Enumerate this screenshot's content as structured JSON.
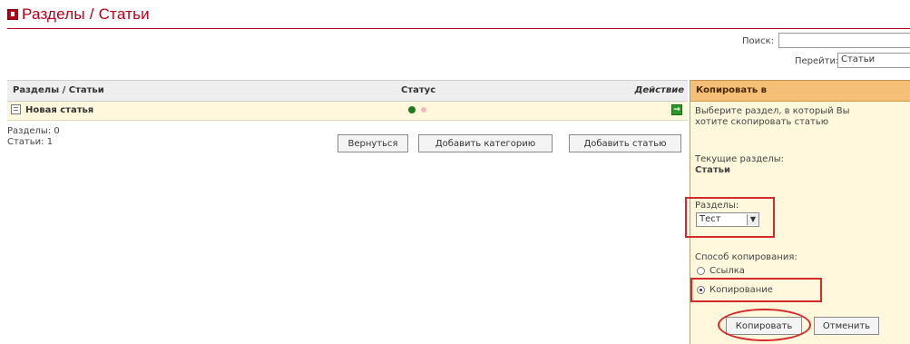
{
  "header": {
    "title": "Разделы / Статьи",
    "search_label": "Поиск:",
    "search_value": "",
    "goto_label": "Перейти:",
    "goto_selected": "Статьи"
  },
  "table": {
    "columns": [
      "Разделы / Статьи",
      "Статус",
      "Действие"
    ],
    "rows": [
      {
        "title": "Новая статья"
      }
    ]
  },
  "stats": {
    "sections": "Разделы: 0",
    "articles": "Статьи: 1"
  },
  "buttons": {
    "back": "Вернуться",
    "add_category": "Добавить категорию",
    "add_article": "Добавить статью"
  },
  "copy_panel": {
    "header": "Копировать в",
    "instructions_1": "Выберите раздел, в который Вы",
    "instructions_2": "хотите скопировать статью",
    "current_label": "Текущие разделы:",
    "current_value": "Статьи",
    "sections_label": "Разделы:",
    "sections_selected": "Тест",
    "method_label": "Способ копирования:",
    "option_link": "Ссылка",
    "option_copy": "Копирование",
    "selected_option": "Копирование",
    "copy_button": "Копировать",
    "cancel_button": "Отменить"
  },
  "colors": {
    "accent": "#b40018",
    "panel_header": "#f6bf78",
    "row_background": "#fff8dc",
    "annotation": "#d42a2a"
  }
}
